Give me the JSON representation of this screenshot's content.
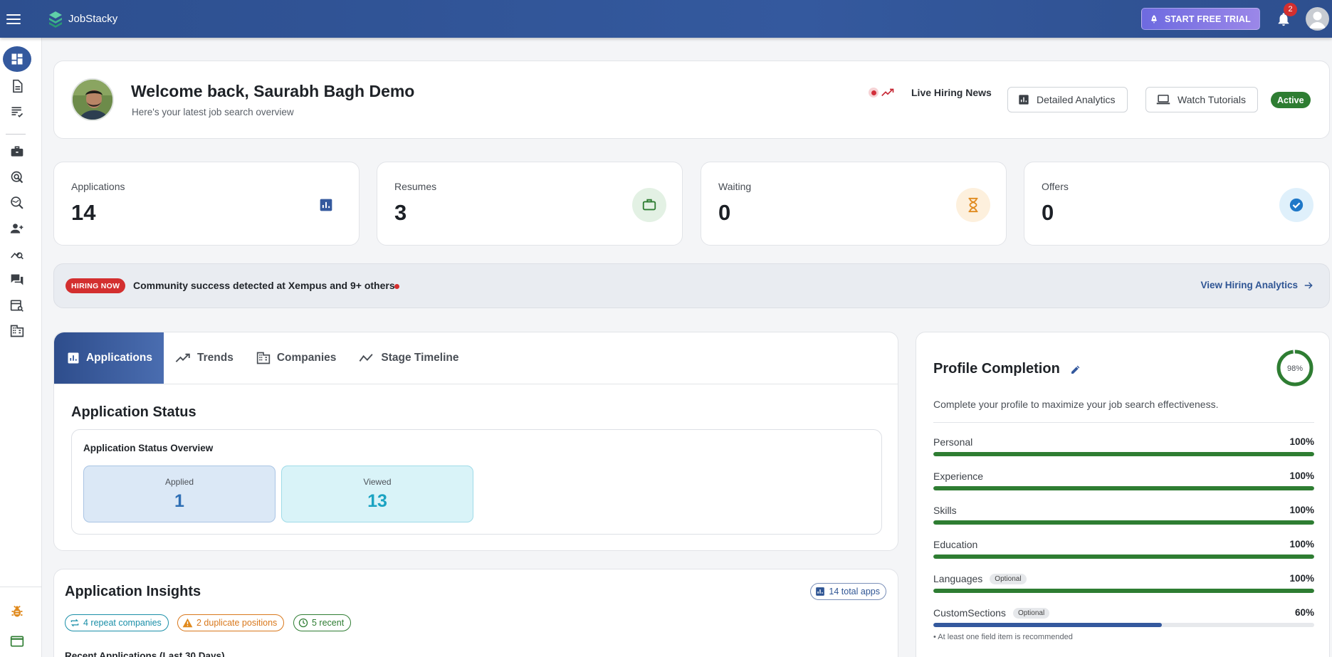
{
  "topbar": {
    "brand": "JobStacky",
    "trial_label": "START FREE TRIAL",
    "notification_count": "2"
  },
  "welcome": {
    "title": "Welcome back, Saurabh Bagh Demo",
    "subtitle": "Here's your latest job search overview",
    "live_news": "Live Hiring News",
    "analytics_btn": "Detailed Analytics",
    "tutorials_btn": "Watch Tutorials",
    "status": "Active"
  },
  "stats": [
    {
      "label": "Applications",
      "value": "14",
      "icon": "bar-chart-icon"
    },
    {
      "label": "Resumes",
      "value": "3",
      "icon": "briefcase-icon"
    },
    {
      "label": "Waiting",
      "value": "0",
      "icon": "hourglass-icon"
    },
    {
      "label": "Offers",
      "value": "0",
      "icon": "check-circle-icon"
    }
  ],
  "hiring": {
    "chip": "HIRING NOW",
    "text": "Community success detected at Xempus and 9+ others",
    "link": "View Hiring Analytics"
  },
  "tabs": [
    {
      "label": "Applications",
      "active": true
    },
    {
      "label": "Trends",
      "active": false
    },
    {
      "label": "Companies",
      "active": false
    },
    {
      "label": "Stage Timeline",
      "active": false
    }
  ],
  "status": {
    "title": "Application Status",
    "box_title": "Application Status Overview",
    "tiles": [
      {
        "label": "Applied",
        "value": "1",
        "color": "#2f6fb5"
      },
      {
        "label": "Viewed",
        "value": "13",
        "color": "#1aa3c2"
      }
    ]
  },
  "insights": {
    "title": "Application Insights",
    "total": "14 total apps",
    "chips": [
      {
        "label": "4 repeat companies",
        "color": "#1a8fa8"
      },
      {
        "label": "2 duplicate positions",
        "color": "#d9781c"
      },
      {
        "label": "5 recent",
        "color": "#2e7d32"
      }
    ],
    "recent_label": "Recent Applications (Last 30 Days)"
  },
  "profile": {
    "title": "Profile Completion",
    "percent": 98,
    "percent_label": "98%",
    "description": "Complete your profile to maximize your job search effectiveness.",
    "rows": [
      {
        "name": "Personal",
        "pct": 100,
        "pct_label": "100%",
        "optional": false
      },
      {
        "name": "Experience",
        "pct": 100,
        "pct_label": "100%",
        "optional": false
      },
      {
        "name": "Skills",
        "pct": 100,
        "pct_label": "100%",
        "optional": false
      },
      {
        "name": "Education",
        "pct": 100,
        "pct_label": "100%",
        "optional": false
      },
      {
        "name": "Languages",
        "pct": 100,
        "pct_label": "100%",
        "optional": true
      },
      {
        "name": "CustomSections",
        "pct": 60,
        "pct_label": "60%",
        "optional": true
      }
    ],
    "optional_label": "Optional",
    "hint": "• At least one field item is recommended"
  },
  "colors": {
    "primary": "#34599e",
    "success": "#2e7d32",
    "danger": "#d32f2f",
    "partial": "#34599e"
  }
}
